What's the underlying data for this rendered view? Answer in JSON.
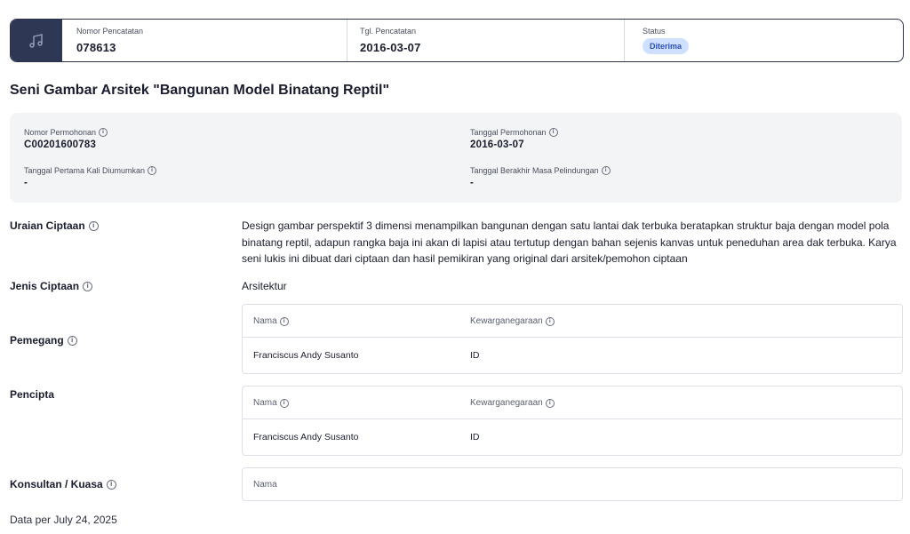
{
  "header": {
    "icon": "music-note-icon",
    "nomor_pencatatan_label": "Nomor Pencatatan",
    "nomor_pencatatan_value": "078613",
    "tgl_pencatatan_label": "Tgl. Pencatatan",
    "tgl_pencatatan_value": "2016-03-07",
    "status_label": "Status",
    "status_value": "Diterima"
  },
  "title": "Seni Gambar Arsitek \"Bangunan Model Binatang Reptil\"",
  "info": {
    "nomor_permohonan_label": "Nomor Permohonan",
    "nomor_permohonan_value": "C00201600783",
    "tanggal_permohonan_label": "Tanggal Permohonan",
    "tanggal_permohonan_value": "2016-03-07",
    "tanggal_pertama_label": "Tanggal Pertama Kali Diumumkan",
    "tanggal_pertama_value": "-",
    "tanggal_berakhir_label": "Tanggal Berakhir Masa Pelindungan",
    "tanggal_berakhir_value": "-"
  },
  "uraian": {
    "label": "Uraian Ciptaan",
    "text": "Design gambar perspektif 3 dimensi menampilkan bangunan dengan satu lantai dak terbuka beratapkan struktur baja dengan model pola binatang reptil, adapun rangka baja ini akan di lapisi atau tertutup dengan bahan sejenis kanvas untuk peneduhan area dak terbuka. Karya seni lukis ini dibuat dari ciptaan dan hasil pemikiran yang original dari arsitek/pemohon ciptaan"
  },
  "jenis": {
    "label": "Jenis Ciptaan",
    "value": "Arsitektur"
  },
  "pemegang": {
    "label": "Pemegang",
    "col_nama": "Nama",
    "col_kewarganegaraan": "Kewarganegaraan",
    "rows": [
      {
        "nama": "Franciscus Andy Susanto",
        "kewarganegaraan": "ID"
      }
    ]
  },
  "pencipta": {
    "label": "Pencipta",
    "col_nama": "Nama",
    "col_kewarganegaraan": "Kewarganegaraan",
    "rows": [
      {
        "nama": "Franciscus Andy Susanto",
        "kewarganegaraan": "ID"
      }
    ]
  },
  "konsultan": {
    "label": "Konsultan / Kuasa",
    "col_nama": "Nama"
  },
  "footer": "Data per July 24, 2025",
  "colors": {
    "header_dark": "#2e3754",
    "badge_bg": "#cfe0ff",
    "badge_text": "#2b4fb8",
    "info_bg": "#f3f4f6"
  }
}
